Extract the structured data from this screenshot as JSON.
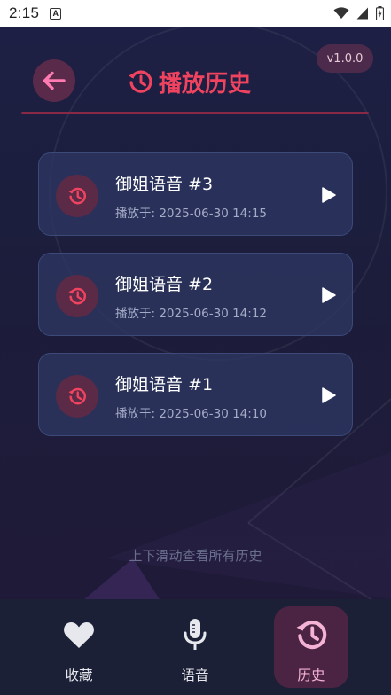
{
  "status_bar": {
    "time": "2:15",
    "app_indicator": "A",
    "icons": [
      "wifi-icon",
      "cell-signal-icon",
      "battery-icon"
    ]
  },
  "header": {
    "title": "播放历史",
    "version": "v1.0.0",
    "icons": {
      "back": "arrow-left-icon",
      "title": "history-icon"
    }
  },
  "history": {
    "items": [
      {
        "title": "御姐语音 #3",
        "time": "播放于: 2025-06-30 14:15"
      },
      {
        "title": "御姐语音 #2",
        "time": "播放于: 2025-06-30 14:12"
      },
      {
        "title": "御姐语音 #1",
        "time": "播放于: 2025-06-30 14:10"
      }
    ],
    "scroll_hint": "上下滑动查看所有历史"
  },
  "bottom_nav": {
    "tabs": [
      {
        "label": "收藏",
        "icon": "heart-icon",
        "active": false
      },
      {
        "label": "语音",
        "icon": "microphone-icon",
        "active": false
      },
      {
        "label": "历史",
        "icon": "history-icon",
        "active": true
      }
    ]
  },
  "colors": {
    "accent": "#f0435f",
    "active_tab_bg": "#4c2443",
    "active_tab_fg": "#f4b2d4",
    "card_bg": "#2d3864",
    "background": "#1c1d3b",
    "nav_bg": "#1b2036"
  }
}
